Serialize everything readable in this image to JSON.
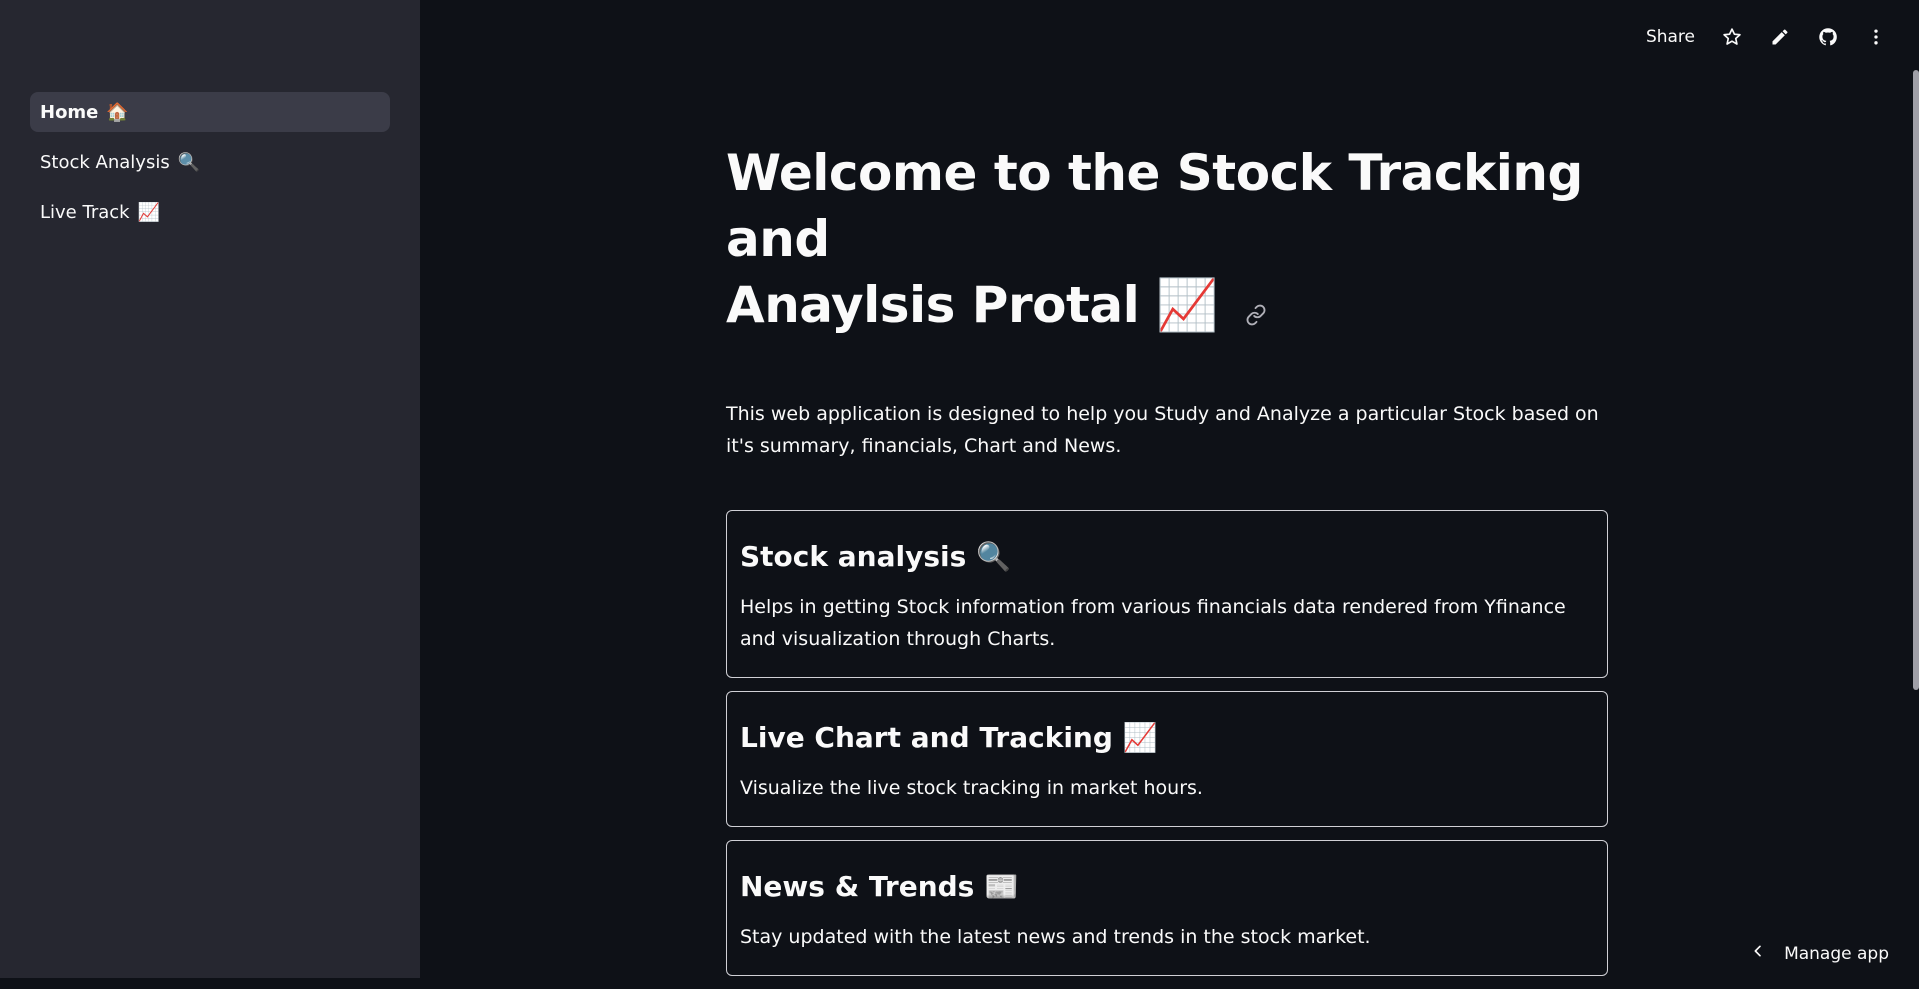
{
  "sidebar": {
    "items": [
      {
        "label": "Home",
        "emoji": "🏠",
        "active": true
      },
      {
        "label": "Stock Analysis",
        "emoji": "🔍",
        "active": false
      },
      {
        "label": "Live Track",
        "emoji": "📈",
        "active": false
      }
    ]
  },
  "toolbar": {
    "share_label": "Share",
    "icons": [
      "star-icon",
      "pencil-icon",
      "github-icon",
      "more-vertical-icon"
    ]
  },
  "main": {
    "title_line1": "Welcome to the Stock Tracking and",
    "title_line2": "Anaylsis Protal",
    "title_emoji": "📈",
    "intro": "This web application is designed to help you Study and Analyze a particular Stock based on it's summary, financials, Chart and News.",
    "cards": [
      {
        "title": "Stock analysis",
        "emoji": "🔍",
        "description": "Helps in getting Stock information from various financials data rendered from Yfinance and visualization through Charts."
      },
      {
        "title": "Live Chart and Tracking",
        "emoji": "📈",
        "description": "Visualize the live stock tracking in market hours."
      },
      {
        "title": "News & Trends",
        "emoji": "📰",
        "description": "Stay updated with the latest news and trends in the stock market."
      }
    ]
  },
  "footer": {
    "manage_app_label": "Manage app"
  },
  "colors": {
    "background": "#0e1117",
    "sidebar": "#262730",
    "text": "#fafafa",
    "card_border": "#d0d0d6"
  }
}
